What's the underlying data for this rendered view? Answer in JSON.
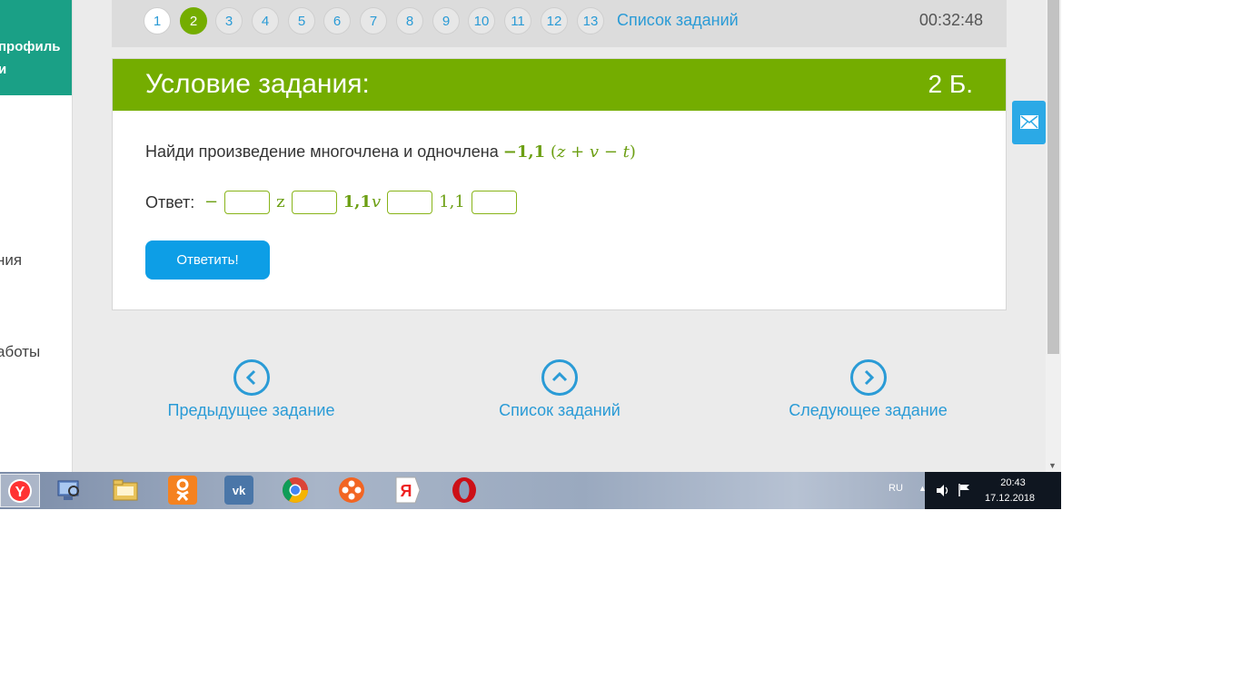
{
  "sidebar": {
    "profile_line1": "профиль",
    "profile_line2": "и",
    "menu_item_1": "ния",
    "menu_item_2": "аботы"
  },
  "topnav": {
    "task_numbers": [
      "1",
      "2",
      "3",
      "4",
      "5",
      "6",
      "7",
      "8",
      "9",
      "10",
      "11",
      "12",
      "13"
    ],
    "current_task": "2",
    "task_list_link": "Список заданий",
    "timer": "00:32:48"
  },
  "card": {
    "title": "Условие задания:",
    "points": "2 Б.",
    "question_text": "Найди произведение многочлена и одночлена",
    "answer_label": "Ответ:",
    "submit_label": "Ответить!"
  },
  "bottom_nav": {
    "prev_label": "Предыдущее задание",
    "list_label": "Список заданий",
    "next_label": "Следующее задание"
  },
  "taskbar": {
    "lang": "RU",
    "time": "20:43",
    "date": "17.12.2018"
  },
  "colors": {
    "accent_green": "#74ad00",
    "link_blue": "#2a9bd6",
    "button_blue": "#0d9ee6",
    "sidebar_teal": "#1aa086"
  }
}
